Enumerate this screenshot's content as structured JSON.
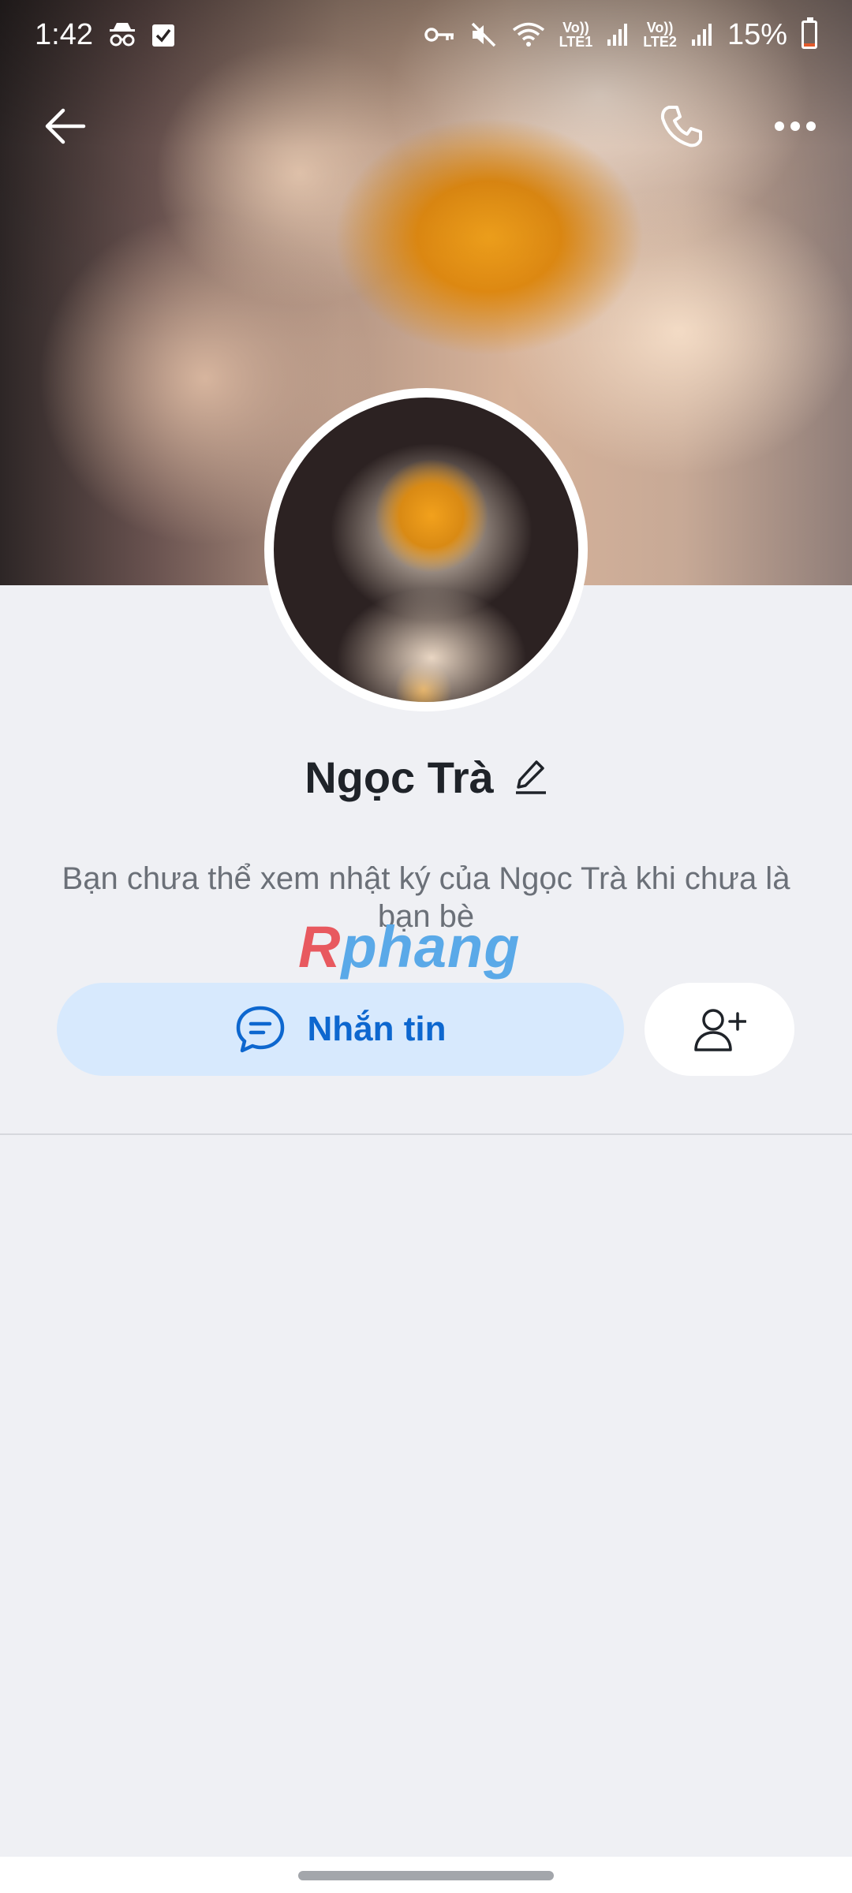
{
  "status_bar": {
    "time": "1:42",
    "volte1_top": "Vo))",
    "volte1_bottom": "LTE1",
    "volte2_top": "Vo))",
    "volte2_bottom": "LTE2",
    "battery_percent_text": "15%",
    "battery_level": 0.15,
    "icons": [
      "incognito-icon",
      "checkbox-icon",
      "vpn-key-icon",
      "mute-icon",
      "wifi-icon",
      "signal-icon",
      "battery-icon"
    ]
  },
  "topbar": {
    "icons": [
      "back-arrow-icon",
      "phone-icon",
      "more-options-icon"
    ]
  },
  "profile": {
    "name": "Ngọc Trà",
    "note": "Bạn chưa thể xem nhật ký của Ngọc Trà khi chưa là bạn bè"
  },
  "watermark": {
    "first": "R",
    "rest": "phang"
  },
  "actions": {
    "message_label": "Nhắn tin",
    "add_friend_icon": "add-friend-icon"
  },
  "colors": {
    "background": "#eff0f4",
    "accent": "#0d67cf",
    "message_button_bg": "#d7e9fd"
  }
}
